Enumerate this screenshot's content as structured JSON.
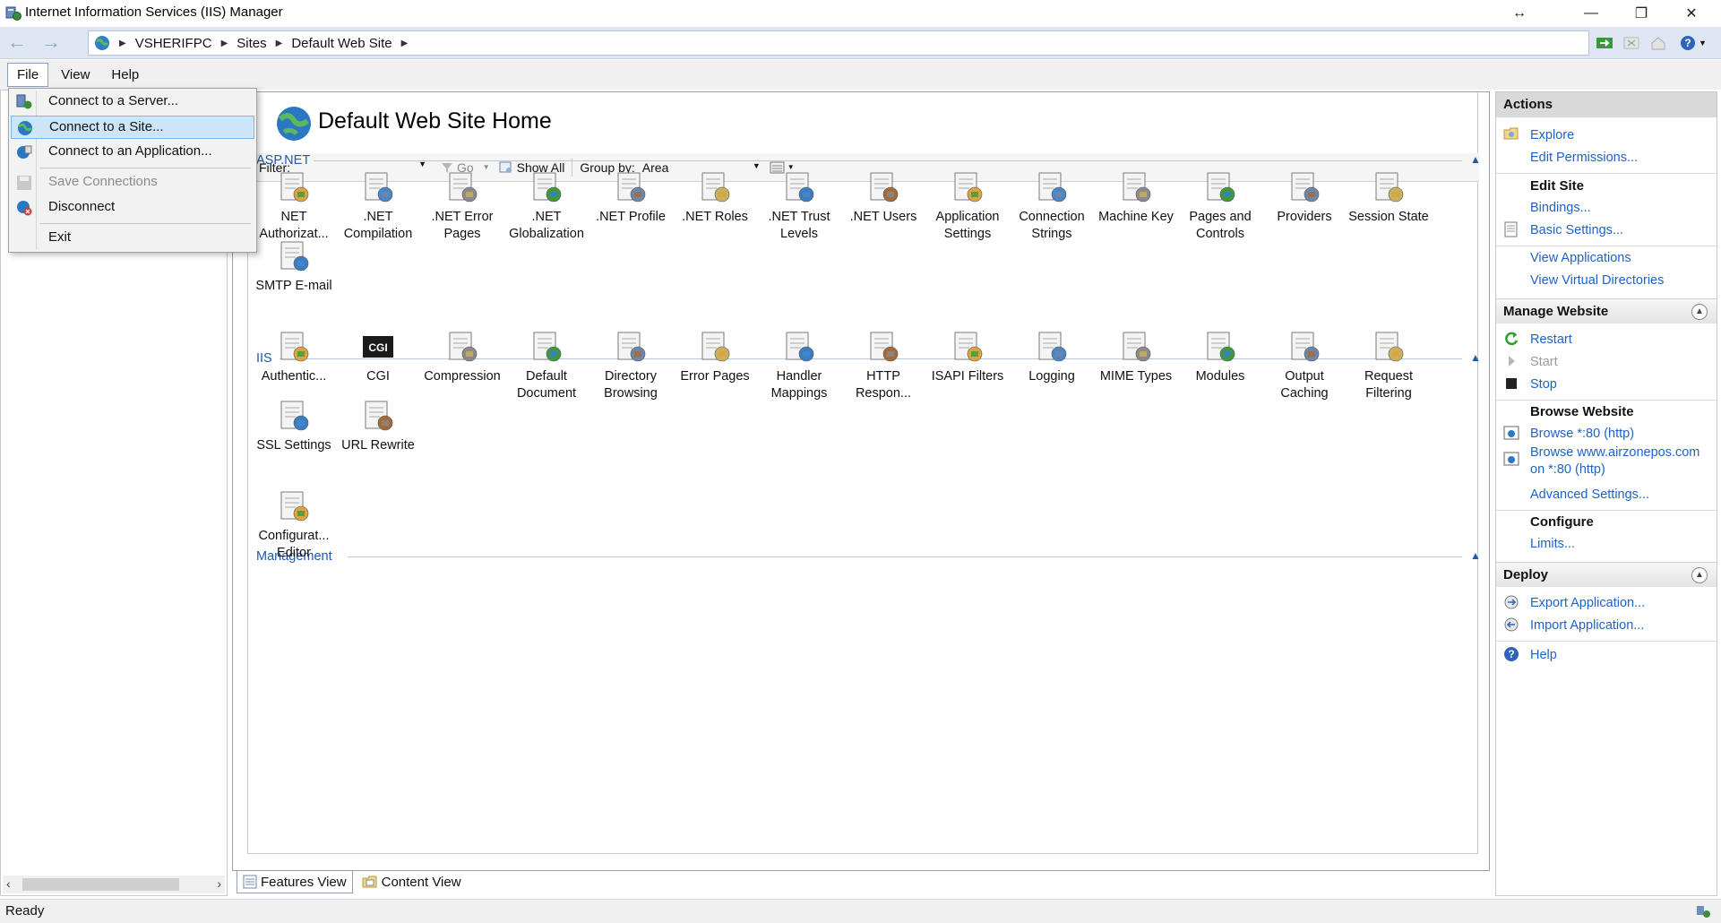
{
  "window": {
    "title": "Internet Information Services (IIS) Manager"
  },
  "address": {
    "crumbs": [
      "VSHERIFPC",
      "Sites",
      "Default Web Site"
    ]
  },
  "menu": {
    "items": [
      "File",
      "View",
      "Help"
    ]
  },
  "file_menu": {
    "connect_server": "Connect to a Server...",
    "connect_site": "Connect to a Site...",
    "connect_app": "Connect to an Application...",
    "save_connections": "Save Connections",
    "disconnect": "Disconnect",
    "exit": "Exit"
  },
  "main": {
    "title": "Default Web Site Home",
    "filter_label": "Filter:",
    "go_label": "Go",
    "show_all_label": "Show All",
    "group_by_label": "Group by:",
    "group_by_value": "Area"
  },
  "groups": {
    "aspnet": {
      "label": "ASP.NET",
      "features": [
        [
          "NET",
          "Authorizat..."
        ],
        [
          ".NET",
          "Compilation"
        ],
        [
          ".NET Error",
          "Pages"
        ],
        [
          ".NET",
          "Globalization"
        ],
        [
          ".NET Profile",
          ""
        ],
        [
          ".NET Roles",
          ""
        ],
        [
          ".NET Trust",
          "Levels"
        ],
        [
          ".NET Users",
          ""
        ],
        [
          "Application",
          "Settings"
        ],
        [
          "Connection",
          "Strings"
        ],
        [
          "Machine Key",
          ""
        ],
        [
          "Pages and",
          "Controls"
        ],
        [
          "Providers",
          ""
        ],
        [
          "Session State",
          ""
        ],
        [
          "SMTP E-mail",
          ""
        ]
      ]
    },
    "iis": {
      "label": "IIS",
      "features": [
        [
          "Authentic...",
          ""
        ],
        [
          "CGI",
          ""
        ],
        [
          "Compression",
          ""
        ],
        [
          "Default",
          "Document"
        ],
        [
          "Directory",
          "Browsing"
        ],
        [
          "Error Pages",
          ""
        ],
        [
          "Handler",
          "Mappings"
        ],
        [
          "HTTP",
          "Respon..."
        ],
        [
          "ISAPI Filters",
          ""
        ],
        [
          "Logging",
          ""
        ],
        [
          "MIME Types",
          ""
        ],
        [
          "Modules",
          ""
        ],
        [
          "Output",
          "Caching"
        ],
        [
          "Request",
          "Filtering"
        ],
        [
          "SSL Settings",
          ""
        ],
        [
          "URL Rewrite",
          ""
        ]
      ]
    },
    "management": {
      "label": "Management",
      "features": [
        [
          "Configurat...",
          "Editor"
        ]
      ]
    }
  },
  "view_tabs": {
    "features": "Features View",
    "content": "Content View"
  },
  "status": {
    "text": "Ready"
  },
  "actions": {
    "header": "Actions",
    "explore": "Explore",
    "edit_permissions": "Edit Permissions...",
    "edit_site": "Edit Site",
    "bindings": "Bindings...",
    "basic_settings": "Basic Settings...",
    "view_applications": "View Applications",
    "view_virtual_dirs": "View Virtual Directories",
    "manage_website": "Manage Website",
    "restart": "Restart",
    "start": "Start",
    "stop": "Stop",
    "browse_website": "Browse Website",
    "browse_80": "Browse *:80 (http)",
    "browse_www_1": "Browse www.airzonepos.com",
    "browse_www_2": "on *:80 (http)",
    "advanced_settings": "Advanced Settings...",
    "configure": "Configure",
    "limits": "Limits...",
    "deploy": "Deploy",
    "export_app": "Export Application...",
    "import_app": "Import Application...",
    "help": "Help"
  }
}
